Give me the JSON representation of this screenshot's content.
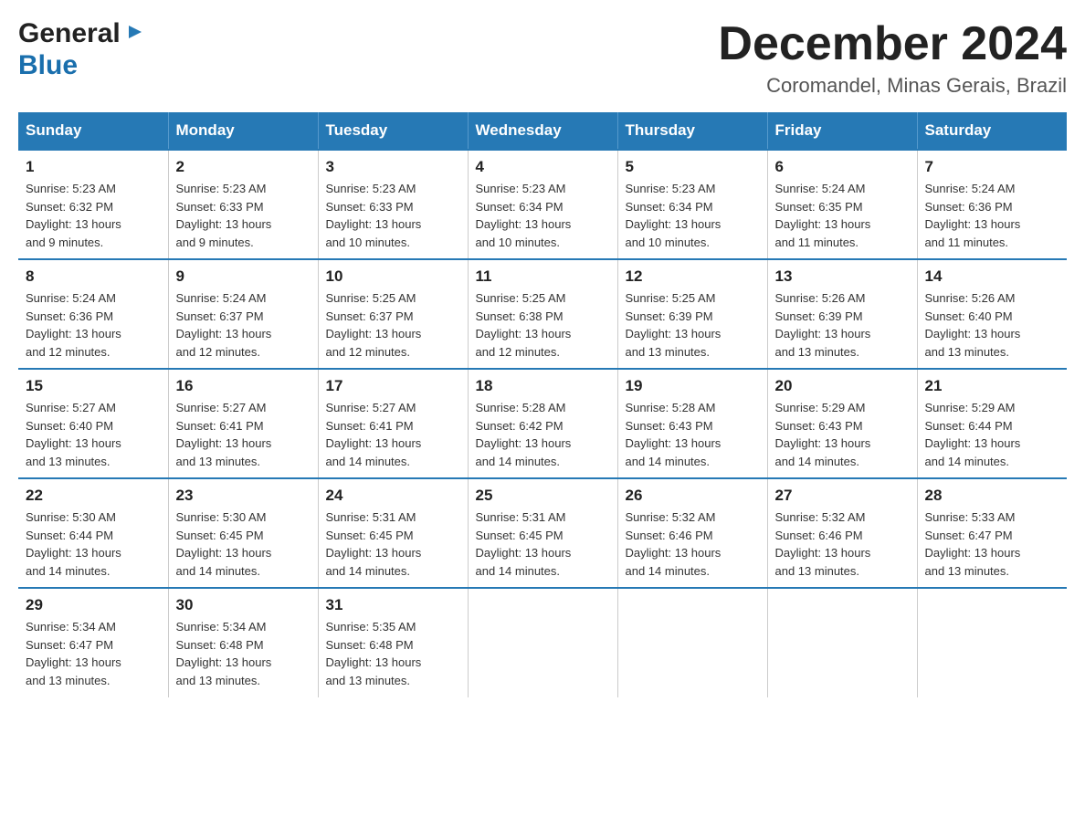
{
  "header": {
    "logo_line1": "General",
    "logo_line2": "Blue",
    "month_title": "December 2024",
    "location": "Coromandel, Minas Gerais, Brazil"
  },
  "days_of_week": [
    "Sunday",
    "Monday",
    "Tuesday",
    "Wednesday",
    "Thursday",
    "Friday",
    "Saturday"
  ],
  "weeks": [
    [
      {
        "day": "1",
        "sunrise": "5:23 AM",
        "sunset": "6:32 PM",
        "daylight": "13 hours and 9 minutes."
      },
      {
        "day": "2",
        "sunrise": "5:23 AM",
        "sunset": "6:33 PM",
        "daylight": "13 hours and 9 minutes."
      },
      {
        "day": "3",
        "sunrise": "5:23 AM",
        "sunset": "6:33 PM",
        "daylight": "13 hours and 10 minutes."
      },
      {
        "day": "4",
        "sunrise": "5:23 AM",
        "sunset": "6:34 PM",
        "daylight": "13 hours and 10 minutes."
      },
      {
        "day": "5",
        "sunrise": "5:23 AM",
        "sunset": "6:34 PM",
        "daylight": "13 hours and 10 minutes."
      },
      {
        "day": "6",
        "sunrise": "5:24 AM",
        "sunset": "6:35 PM",
        "daylight": "13 hours and 11 minutes."
      },
      {
        "day": "7",
        "sunrise": "5:24 AM",
        "sunset": "6:36 PM",
        "daylight": "13 hours and 11 minutes."
      }
    ],
    [
      {
        "day": "8",
        "sunrise": "5:24 AM",
        "sunset": "6:36 PM",
        "daylight": "13 hours and 12 minutes."
      },
      {
        "day": "9",
        "sunrise": "5:24 AM",
        "sunset": "6:37 PM",
        "daylight": "13 hours and 12 minutes."
      },
      {
        "day": "10",
        "sunrise": "5:25 AM",
        "sunset": "6:37 PM",
        "daylight": "13 hours and 12 minutes."
      },
      {
        "day": "11",
        "sunrise": "5:25 AM",
        "sunset": "6:38 PM",
        "daylight": "13 hours and 12 minutes."
      },
      {
        "day": "12",
        "sunrise": "5:25 AM",
        "sunset": "6:39 PM",
        "daylight": "13 hours and 13 minutes."
      },
      {
        "day": "13",
        "sunrise": "5:26 AM",
        "sunset": "6:39 PM",
        "daylight": "13 hours and 13 minutes."
      },
      {
        "day": "14",
        "sunrise": "5:26 AM",
        "sunset": "6:40 PM",
        "daylight": "13 hours and 13 minutes."
      }
    ],
    [
      {
        "day": "15",
        "sunrise": "5:27 AM",
        "sunset": "6:40 PM",
        "daylight": "13 hours and 13 minutes."
      },
      {
        "day": "16",
        "sunrise": "5:27 AM",
        "sunset": "6:41 PM",
        "daylight": "13 hours and 13 minutes."
      },
      {
        "day": "17",
        "sunrise": "5:27 AM",
        "sunset": "6:41 PM",
        "daylight": "13 hours and 14 minutes."
      },
      {
        "day": "18",
        "sunrise": "5:28 AM",
        "sunset": "6:42 PM",
        "daylight": "13 hours and 14 minutes."
      },
      {
        "day": "19",
        "sunrise": "5:28 AM",
        "sunset": "6:43 PM",
        "daylight": "13 hours and 14 minutes."
      },
      {
        "day": "20",
        "sunrise": "5:29 AM",
        "sunset": "6:43 PM",
        "daylight": "13 hours and 14 minutes."
      },
      {
        "day": "21",
        "sunrise": "5:29 AM",
        "sunset": "6:44 PM",
        "daylight": "13 hours and 14 minutes."
      }
    ],
    [
      {
        "day": "22",
        "sunrise": "5:30 AM",
        "sunset": "6:44 PM",
        "daylight": "13 hours and 14 minutes."
      },
      {
        "day": "23",
        "sunrise": "5:30 AM",
        "sunset": "6:45 PM",
        "daylight": "13 hours and 14 minutes."
      },
      {
        "day": "24",
        "sunrise": "5:31 AM",
        "sunset": "6:45 PM",
        "daylight": "13 hours and 14 minutes."
      },
      {
        "day": "25",
        "sunrise": "5:31 AM",
        "sunset": "6:45 PM",
        "daylight": "13 hours and 14 minutes."
      },
      {
        "day": "26",
        "sunrise": "5:32 AM",
        "sunset": "6:46 PM",
        "daylight": "13 hours and 14 minutes."
      },
      {
        "day": "27",
        "sunrise": "5:32 AM",
        "sunset": "6:46 PM",
        "daylight": "13 hours and 13 minutes."
      },
      {
        "day": "28",
        "sunrise": "5:33 AM",
        "sunset": "6:47 PM",
        "daylight": "13 hours and 13 minutes."
      }
    ],
    [
      {
        "day": "29",
        "sunrise": "5:34 AM",
        "sunset": "6:47 PM",
        "daylight": "13 hours and 13 minutes."
      },
      {
        "day": "30",
        "sunrise": "5:34 AM",
        "sunset": "6:48 PM",
        "daylight": "13 hours and 13 minutes."
      },
      {
        "day": "31",
        "sunrise": "5:35 AM",
        "sunset": "6:48 PM",
        "daylight": "13 hours and 13 minutes."
      },
      null,
      null,
      null,
      null
    ]
  ],
  "labels": {
    "sunrise": "Sunrise:",
    "sunset": "Sunset:",
    "daylight": "Daylight:"
  },
  "colors": {
    "header_bg": "#2679b5",
    "header_text": "#ffffff",
    "border": "#2679b5"
  }
}
